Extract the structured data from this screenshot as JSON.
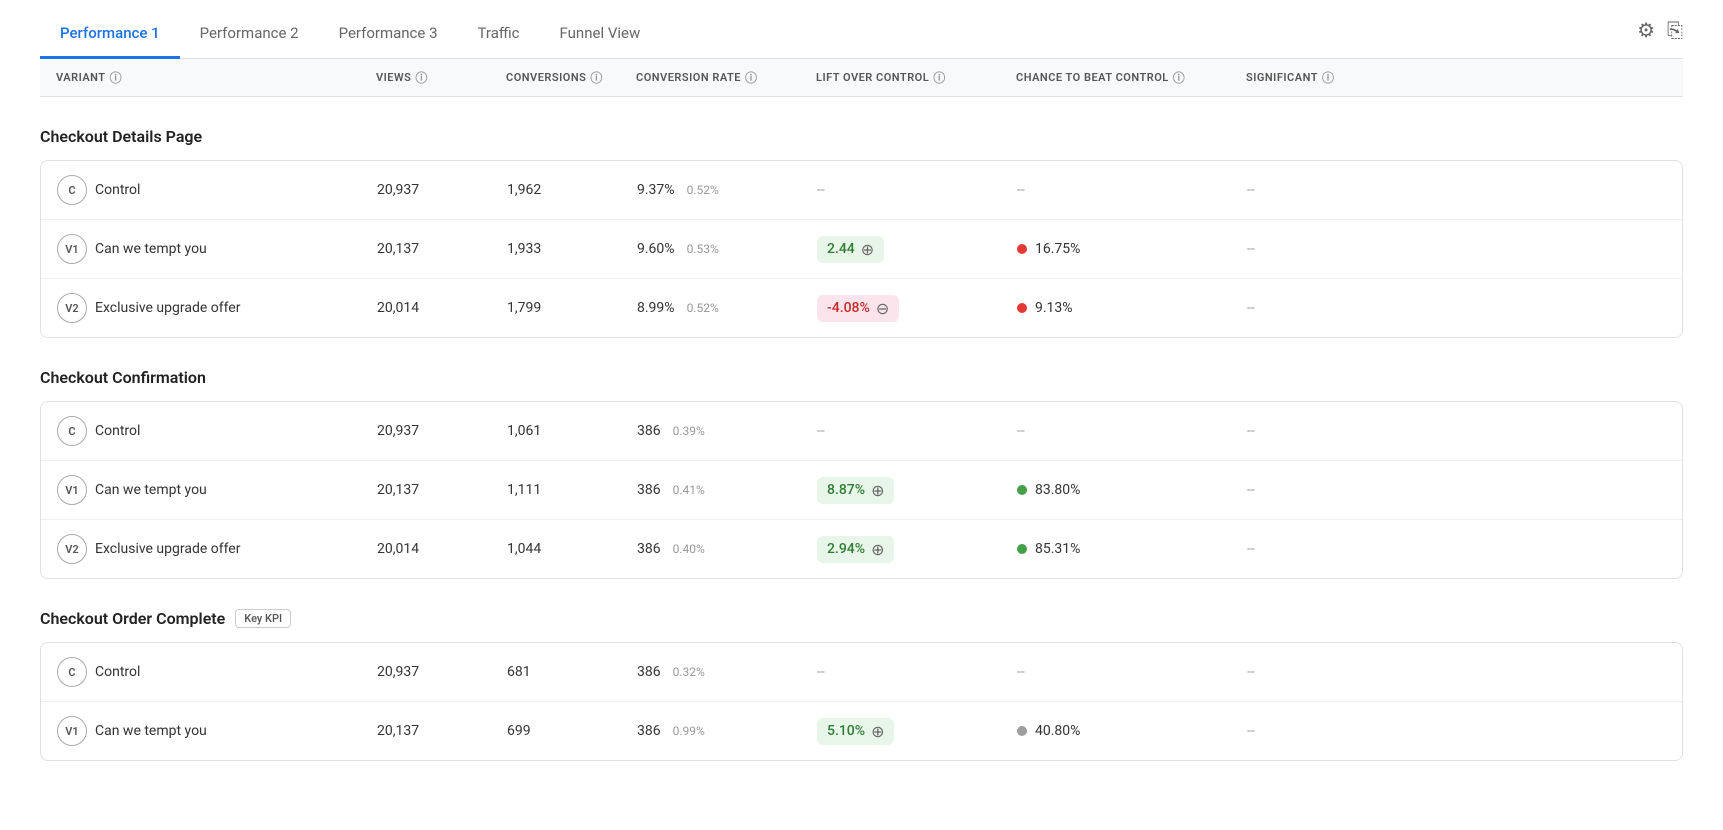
{
  "tabs": [
    {
      "id": "perf1",
      "label": "Performance 1",
      "active": true
    },
    {
      "id": "perf2",
      "label": "Performance 2",
      "active": false
    },
    {
      "id": "perf3",
      "label": "Performance 3",
      "active": false
    },
    {
      "id": "traffic",
      "label": "Traffic",
      "active": false
    },
    {
      "id": "funnel",
      "label": "Funnel View",
      "active": false
    }
  ],
  "columns": [
    {
      "key": "variant",
      "label": "VARIANT"
    },
    {
      "key": "views",
      "label": "VIEWS"
    },
    {
      "key": "conversions",
      "label": "CONVERSIONS"
    },
    {
      "key": "conv_rate",
      "label": "CONVERSION RATE"
    },
    {
      "key": "lift",
      "label": "LIFT OVER CONTROL"
    },
    {
      "key": "chance",
      "label": "CHANCE TO BEAT CONTROL"
    },
    {
      "key": "significant",
      "label": "SIGNIFICANT"
    }
  ],
  "sections": [
    {
      "id": "checkout-details",
      "title": "Checkout Details Page",
      "keyKpi": false,
      "rows": [
        {
          "badgeText": "C",
          "name": "Control",
          "views": "20,937",
          "conversions": "1,962",
          "convRate": "9.37%",
          "convRateSec": "0.52%",
          "lift": null,
          "liftType": "none",
          "chance": null,
          "chanceColor": "none",
          "significant": "--"
        },
        {
          "badgeText": "V1",
          "name": "Can we tempt you",
          "views": "20,137",
          "conversions": "1,933",
          "convRate": "9.60%",
          "convRateSec": "0.53%",
          "lift": "2.44",
          "liftType": "positive",
          "chance": "16.75%",
          "chanceColor": "red",
          "significant": "--"
        },
        {
          "badgeText": "V2",
          "name": "Exclusive upgrade offer",
          "views": "20,014",
          "conversions": "1,799",
          "convRate": "8.99%",
          "convRateSec": "0.52%",
          "lift": "-4.08%",
          "liftType": "negative",
          "chance": "9.13%",
          "chanceColor": "red",
          "significant": "--"
        }
      ]
    },
    {
      "id": "checkout-confirmation",
      "title": "Checkout Confirmation",
      "keyKpi": false,
      "rows": [
        {
          "badgeText": "C",
          "name": "Control",
          "views": "20,937",
          "conversions": "1,061",
          "convRate": "386",
          "convRateSec": "0.39%",
          "lift": null,
          "liftType": "none",
          "chance": null,
          "chanceColor": "none",
          "significant": "--"
        },
        {
          "badgeText": "V1",
          "name": "Can we tempt you",
          "views": "20,137",
          "conversions": "1,111",
          "convRate": "386",
          "convRateSec": "0.41%",
          "lift": "8.87%",
          "liftType": "positive",
          "chance": "83.80%",
          "chanceColor": "green",
          "significant": "--"
        },
        {
          "badgeText": "V2",
          "name": "Exclusive upgrade offer",
          "views": "20,014",
          "conversions": "1,044",
          "convRate": "386",
          "convRateSec": "0.40%",
          "lift": "2.94%",
          "liftType": "positive",
          "chance": "85.31%",
          "chanceColor": "green",
          "significant": "--"
        }
      ]
    },
    {
      "id": "checkout-order-complete",
      "title": "Checkout Order Complete",
      "keyKpi": true,
      "keyKpiLabel": "Key KPI",
      "rows": [
        {
          "badgeText": "C",
          "name": "Control",
          "views": "20,937",
          "conversions": "681",
          "convRate": "386",
          "convRateSec": "0.32%",
          "lift": null,
          "liftType": "none",
          "chance": null,
          "chanceColor": "none",
          "significant": "--"
        },
        {
          "badgeText": "V1",
          "name": "Can we tempt you",
          "views": "20,137",
          "conversions": "699",
          "convRate": "386",
          "convRateSec": "0.99%",
          "lift": "5.10%",
          "liftType": "positive",
          "chance": "40.80%",
          "chanceColor": "gray",
          "significant": "--"
        }
      ]
    }
  ]
}
